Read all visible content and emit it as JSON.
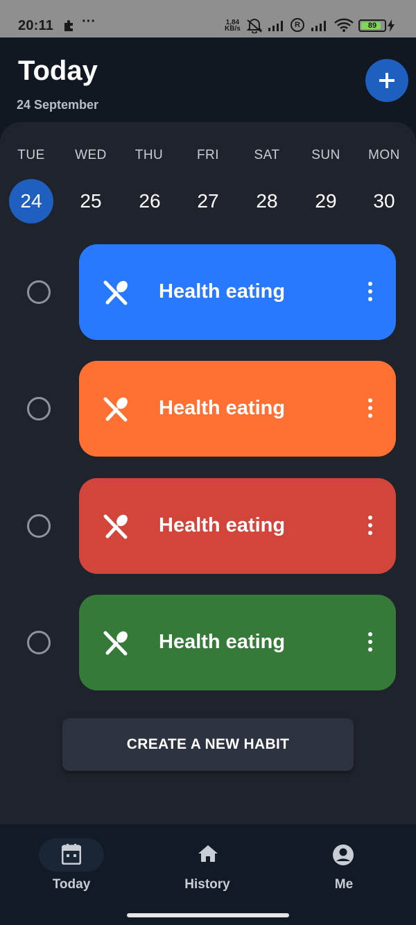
{
  "status_bar": {
    "time": "20:11",
    "network_speed_value": "1,84",
    "network_speed_unit": "KB/s",
    "roaming_badge": "R",
    "battery_level": "89",
    "battery_fraction": 0.89,
    "icons": [
      "puzzle-icon",
      "more-icon",
      "mute-icon",
      "signal-icon",
      "roaming-icon",
      "signal-icon",
      "wifi-icon",
      "battery-icon",
      "charging-icon"
    ]
  },
  "header": {
    "title": "Today",
    "date": "24 September",
    "add_button_icon": "plus-icon"
  },
  "calendar": {
    "days": [
      {
        "name": "TUE",
        "number": "24",
        "selected": true
      },
      {
        "name": "WED",
        "number": "25",
        "selected": false
      },
      {
        "name": "THU",
        "number": "26",
        "selected": false
      },
      {
        "name": "FRI",
        "number": "27",
        "selected": false
      },
      {
        "name": "SAT",
        "number": "28",
        "selected": false
      },
      {
        "name": "SUN",
        "number": "29",
        "selected": false
      },
      {
        "name": "MON",
        "number": "30",
        "selected": false
      }
    ],
    "selected_color": "#1e5fbf"
  },
  "habits": [
    {
      "label": "Health eating",
      "color": "#2979ff",
      "icon": "utensils-icon",
      "checked": false
    },
    {
      "label": "Health eating",
      "color": "#ff7032",
      "icon": "utensils-icon",
      "checked": false
    },
    {
      "label": "Health eating",
      "color": "#d2453b",
      "icon": "utensils-icon",
      "checked": false
    },
    {
      "label": "Health eating",
      "color": "#357a38",
      "icon": "utensils-icon",
      "checked": false
    }
  ],
  "create_button": {
    "label": "CREATE A NEW HABIT"
  },
  "bottom_nav": {
    "items": [
      {
        "label": "Today",
        "icon": "calendar-icon",
        "active": true
      },
      {
        "label": "History",
        "icon": "home-icon",
        "active": false
      },
      {
        "label": "Me",
        "icon": "account-icon",
        "active": false
      }
    ]
  }
}
